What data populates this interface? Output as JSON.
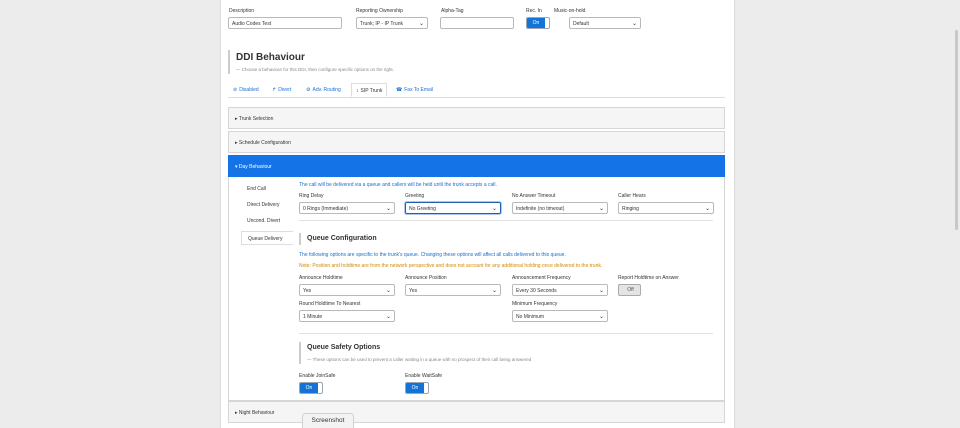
{
  "top_fields": {
    "description_label": "Description",
    "description_value": "Audio Codes Test",
    "ownership_label": "Reporting Ownership",
    "ownership_value": "Trunk; IP - IP Trunk",
    "alpha_label": "Alpha-Tag",
    "alpha_value": "",
    "rec_label": "Rec. In",
    "rec_value": "On",
    "moh_label": "Music-on-hold",
    "moh_value": "Default"
  },
  "ddi": {
    "title": "DDI Behaviour",
    "subtitle": "— Choose a behaviour for this DDI, then configure specific options on the right."
  },
  "tabs": [
    {
      "icon": "⊘",
      "label": "Disabled"
    },
    {
      "icon": "↱",
      "label": "Divert"
    },
    {
      "icon": "⚙",
      "label": "Adv. Routing"
    },
    {
      "icon": "↕",
      "label": "SIP Trunk"
    },
    {
      "icon": "☎",
      "label": "Fax To Email"
    }
  ],
  "sections": {
    "trunk": "▸ Trunk Selection",
    "schedule": "▸ Schedule Configuration",
    "day": "▾ Day Behaviour",
    "night": "▸ Night Behaviour"
  },
  "leftnav": [
    "End Call",
    "Direct Delivery",
    "Uncond. Divert",
    "Queue Delivery"
  ],
  "day": {
    "intro": "The call will be delivered via a queue and callers will be held until the trunk accepts a call.",
    "ring_delay_label": "Ring Delay",
    "ring_delay_value": "0 Rings (Immediate)",
    "greeting_label": "Greeting",
    "greeting_value": "No Greeting",
    "no_answer_label": "No Answer Timeout",
    "no_answer_value": "Indefinite (no timeout)",
    "caller_hears_label": "Caller Hears",
    "caller_hears_value": "Ringing"
  },
  "queue": {
    "title": "Queue Configuration",
    "info": "The following options are specific to the trunk's queue. Changing these options will affect all calls delivered to this queue.",
    "note": "Note: Position and holdtime are from the network perspective and does not account for any additional holding once delivered to the trunk.",
    "announce_holdtime_label": "Announce Holdtime",
    "announce_holdtime_value": "Yes",
    "announce_position_label": "Announce Position",
    "announce_position_value": "Yes",
    "announce_freq_label": "Announcement Frequency",
    "announce_freq_value": "Every 30 Seconds",
    "report_holdtime_label": "Report Holdtime on Answer",
    "report_holdtime_value": "Off",
    "round_label": "Round Holdtime To Nearest",
    "round_value": "1 Minute",
    "min_freq_label": "Minimum Frequency",
    "min_freq_value": "No Minimum"
  },
  "safety": {
    "title": "Queue Safety Options",
    "subtitle": "— These options can be used to prevent a caller waiting in a queue with no prospect of their call being answered",
    "joinsafe_label": "Enable JoinSafe",
    "joinsafe_value": "On",
    "waitsafe_label": "Enable WaitSafe",
    "waitsafe_value": "On"
  },
  "screenshot_tag": "Screenshot",
  "colors": {
    "accent": "#1473e6",
    "link": "#1a6ecf",
    "warning": "#d18a00"
  }
}
